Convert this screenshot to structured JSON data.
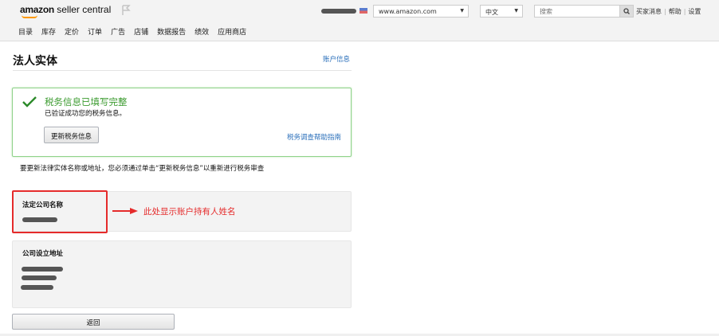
{
  "header": {
    "logo": {
      "brand": "amazon",
      "product": "seller central"
    },
    "nav": [
      "目录",
      "库存",
      "定价",
      "订单",
      "广告",
      "店铺",
      "数据报告",
      "绩效",
      "应用商店"
    ],
    "marketplace": "www.amazon.com",
    "language": "中文",
    "search_placeholder": "搜索",
    "links": [
      "买家消息",
      "帮助",
      "设置"
    ]
  },
  "page": {
    "title": "法人实体",
    "account_info_link": "账户信息",
    "status": {
      "title": "税务信息已填写完整",
      "subtitle": "已验证成功您的税务信息。",
      "update_button": "更新税务信息",
      "help_link": "税务调查帮助指南"
    },
    "note": "要更新法律实体名称或地址，您必须通过单击“更新税务信息”以重新进行税务审查",
    "legal_name_label": "法定公司名称",
    "annotation": "此处显示账户持有人姓名",
    "address_label": "公司设立地址",
    "back_button": "返回"
  },
  "colors": {
    "accent_green": "#3a9a2e",
    "link": "#2a6fba",
    "annotation_red": "#e52b2b"
  }
}
